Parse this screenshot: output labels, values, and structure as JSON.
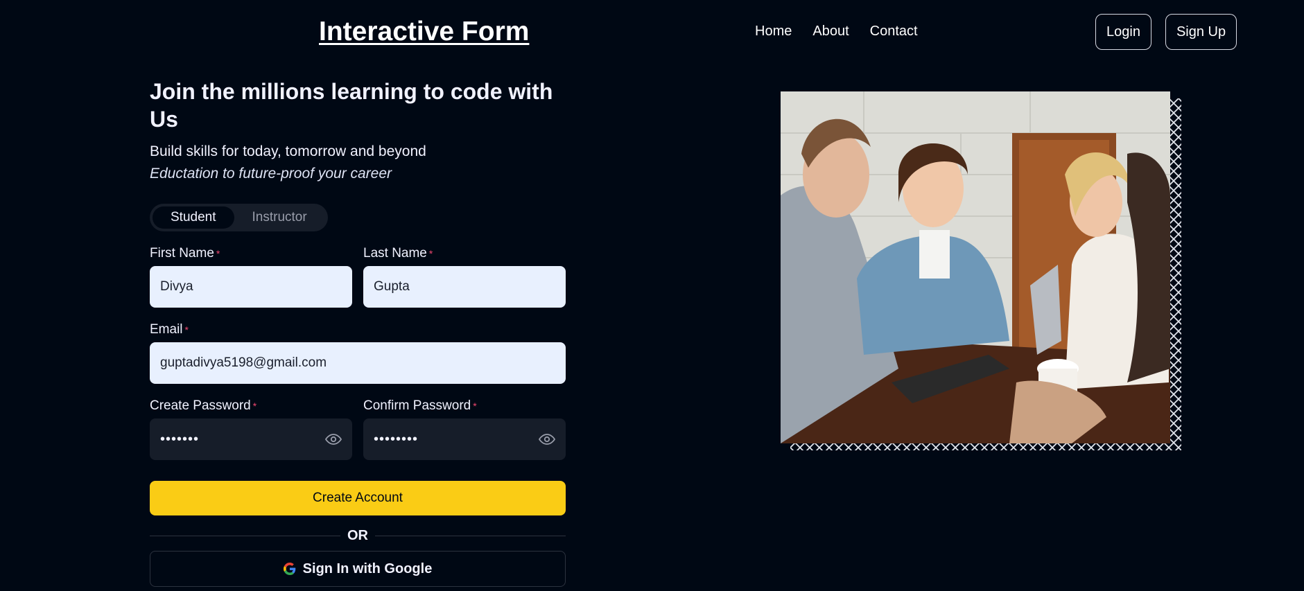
{
  "header": {
    "brand": "Interactive Form",
    "nav": [
      "Home",
      "About",
      "Contact"
    ],
    "login_label": "Login",
    "signup_label": "Sign Up"
  },
  "form": {
    "heading": "Join the millions learning to code with Us",
    "subtitle": "Build skills for today, tomorrow and beyond",
    "tagline": "Eductation to future-proof your career",
    "tabs": [
      {
        "label": "Student",
        "active": true
      },
      {
        "label": "Instructor",
        "active": false
      }
    ],
    "required_mark": "*",
    "first_name": {
      "label": "First Name",
      "value": "Divya"
    },
    "last_name": {
      "label": "Last Name",
      "value": "Gupta"
    },
    "email": {
      "label": "Email",
      "value": "guptadivya5198@gmail.com"
    },
    "create_password": {
      "label": "Create Password",
      "value": "•••••••"
    },
    "confirm_password": {
      "label": "Confirm Password",
      "value": "••••••••"
    },
    "submit_label": "Create Account",
    "divider_label": "OR",
    "google_label": "Sign In with Google"
  },
  "colors": {
    "background": "#000814",
    "accent_yellow": "#facc15",
    "required": "#ef476f",
    "input_light": "#e8f0fe",
    "input_dark": "#161d29"
  },
  "icons": {
    "eye": "eye-icon",
    "google": "google-g-icon"
  }
}
